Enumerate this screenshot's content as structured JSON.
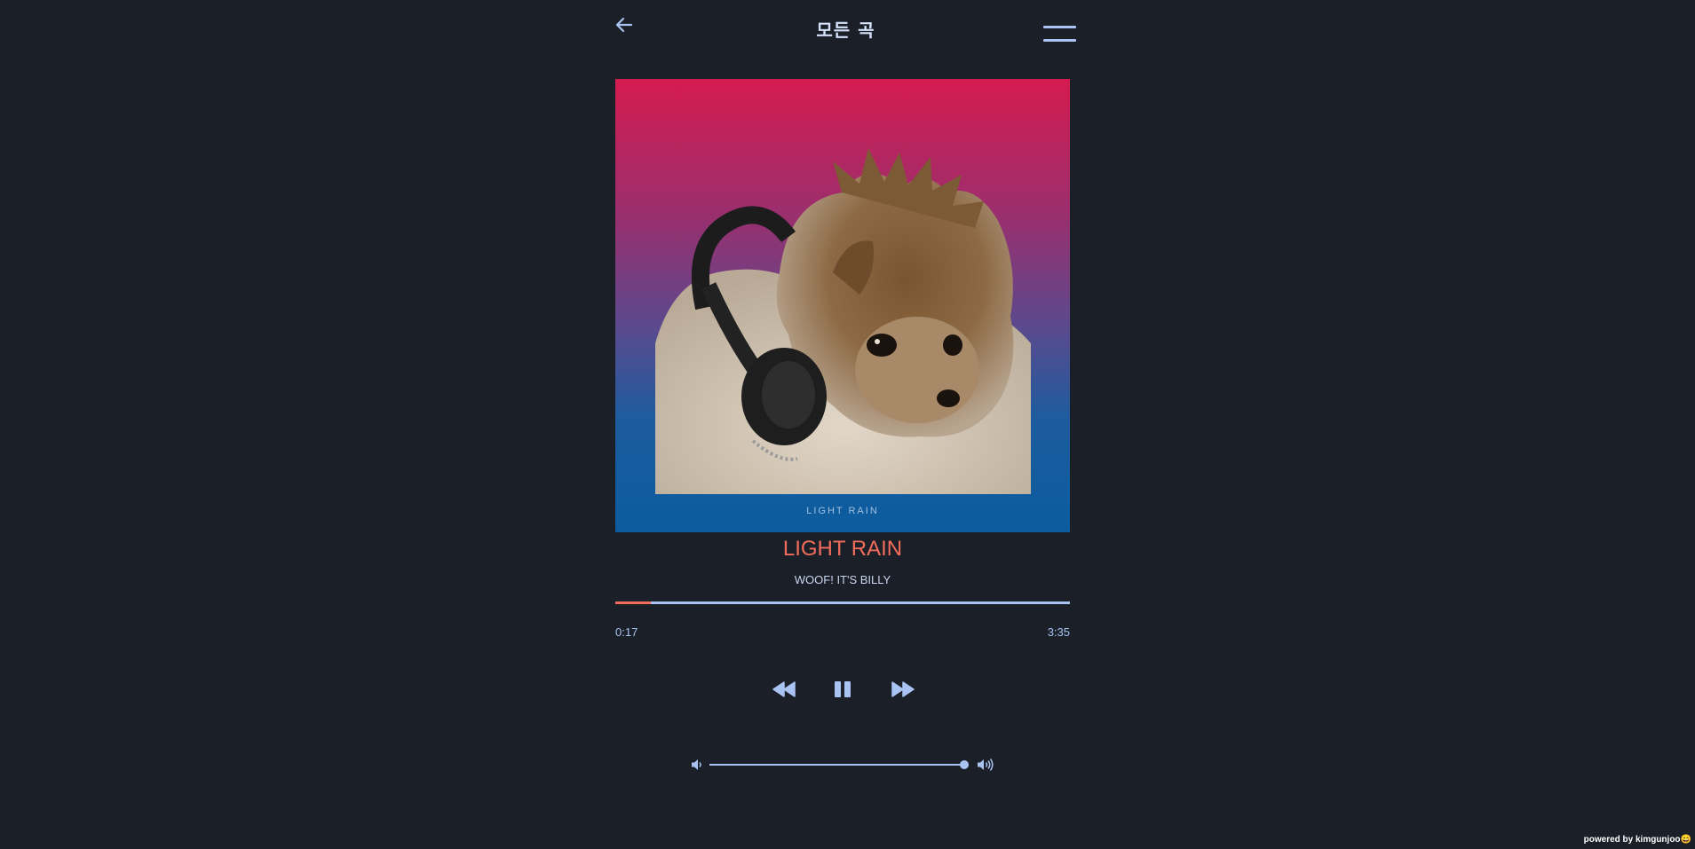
{
  "header": {
    "title": "모든 곡",
    "back_icon": "arrow-left-icon",
    "menu_icon": "hamburger-menu-icon"
  },
  "album": {
    "cover_caption": "LIGHT RAIN",
    "cover_description_icon": "album-cover-image"
  },
  "song": {
    "title": "LIGHT RAIN",
    "artist": "WOOF! IT'S BILLY"
  },
  "progress": {
    "current_time": "0:17",
    "total_time": "3:35",
    "fraction": 0.079
  },
  "controls": {
    "rewind_icon": "rewind-icon",
    "pause_icon": "pause-icon",
    "forward_icon": "fast-forward-icon"
  },
  "volume": {
    "level": 1.0,
    "mute_icon": "volume-low-icon",
    "max_icon": "volume-high-icon"
  },
  "footer": {
    "credit": "powered by kimgunjoo😄"
  },
  "colors": {
    "background": "#1b1f28",
    "accent": "#a9c4f2",
    "title": "#f26d5b",
    "progress_fill": "#f26d5b"
  }
}
